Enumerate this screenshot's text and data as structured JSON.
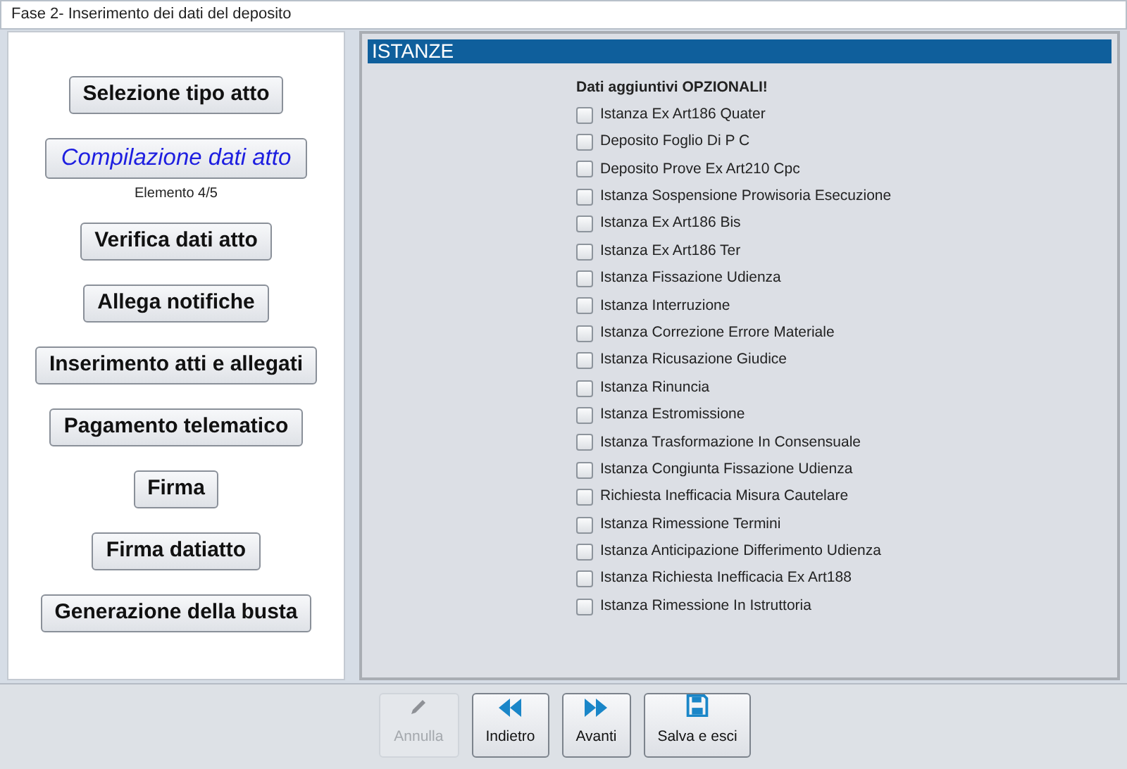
{
  "phase_title": "Fase 2- Inserimento dei dati del deposito",
  "steps": [
    {
      "label": "Selezione tipo atto",
      "current": false
    },
    {
      "label": "Compilazione dati atto",
      "current": true,
      "note": "Elemento 4/5"
    },
    {
      "label": "Verifica dati atto",
      "current": false
    },
    {
      "label": "Allega notifiche",
      "current": false
    },
    {
      "label": "Inserimento atti e allegati",
      "current": false
    },
    {
      "label": "Pagamento telematico",
      "current": false
    },
    {
      "label": "Firma",
      "current": false
    },
    {
      "label": "Firma datiatto",
      "current": false
    },
    {
      "label": "Generazione della busta",
      "current": false
    }
  ],
  "section": {
    "title": "ISTANZE",
    "subtitle": "Dati aggiuntivi OPZIONALI!",
    "options": [
      {
        "label": "Istanza Ex Art186 Quater",
        "checked": false
      },
      {
        "label": "Deposito Foglio Di P C",
        "checked": false
      },
      {
        "label": "Deposito Prove Ex Art210 Cpc",
        "checked": false
      },
      {
        "label": "Istanza Sospensione Prowisoria Esecuzione",
        "checked": false
      },
      {
        "label": "Istanza Ex Art186 Bis",
        "checked": false
      },
      {
        "label": "Istanza Ex Art186 Ter",
        "checked": false
      },
      {
        "label": "Istanza Fissazione Udienza",
        "checked": false
      },
      {
        "label": "Istanza Interruzione",
        "checked": false
      },
      {
        "label": "Istanza Correzione Errore Materiale",
        "checked": false
      },
      {
        "label": "Istanza Ricusazione Giudice",
        "checked": false
      },
      {
        "label": "Istanza Rinuncia",
        "checked": false
      },
      {
        "label": "Istanza Estromissione",
        "checked": false
      },
      {
        "label": "Istanza Trasformazione In Consensuale",
        "checked": false
      },
      {
        "label": "Istanza Congiunta Fissazione Udienza",
        "checked": false
      },
      {
        "label": "Richiesta Inefficacia Misura Cautelare",
        "checked": false
      },
      {
        "label": "Istanza Rimessione Termini",
        "checked": false
      },
      {
        "label": "Istanza Anticipazione Differimento Udienza",
        "checked": false
      },
      {
        "label": "Istanza Richiesta Inefficacia Ex Art188",
        "checked": false
      },
      {
        "label": "Istanza Rimessione In Istruttoria",
        "checked": false
      }
    ]
  },
  "actions": [
    {
      "kind": "edit",
      "label": "Annulla",
      "disabled": true
    },
    {
      "kind": "back",
      "label": "Indietro",
      "disabled": false
    },
    {
      "kind": "forward",
      "label": "Avanti",
      "disabled": false
    },
    {
      "kind": "save",
      "label": "Salva e esci",
      "disabled": false
    }
  ]
}
